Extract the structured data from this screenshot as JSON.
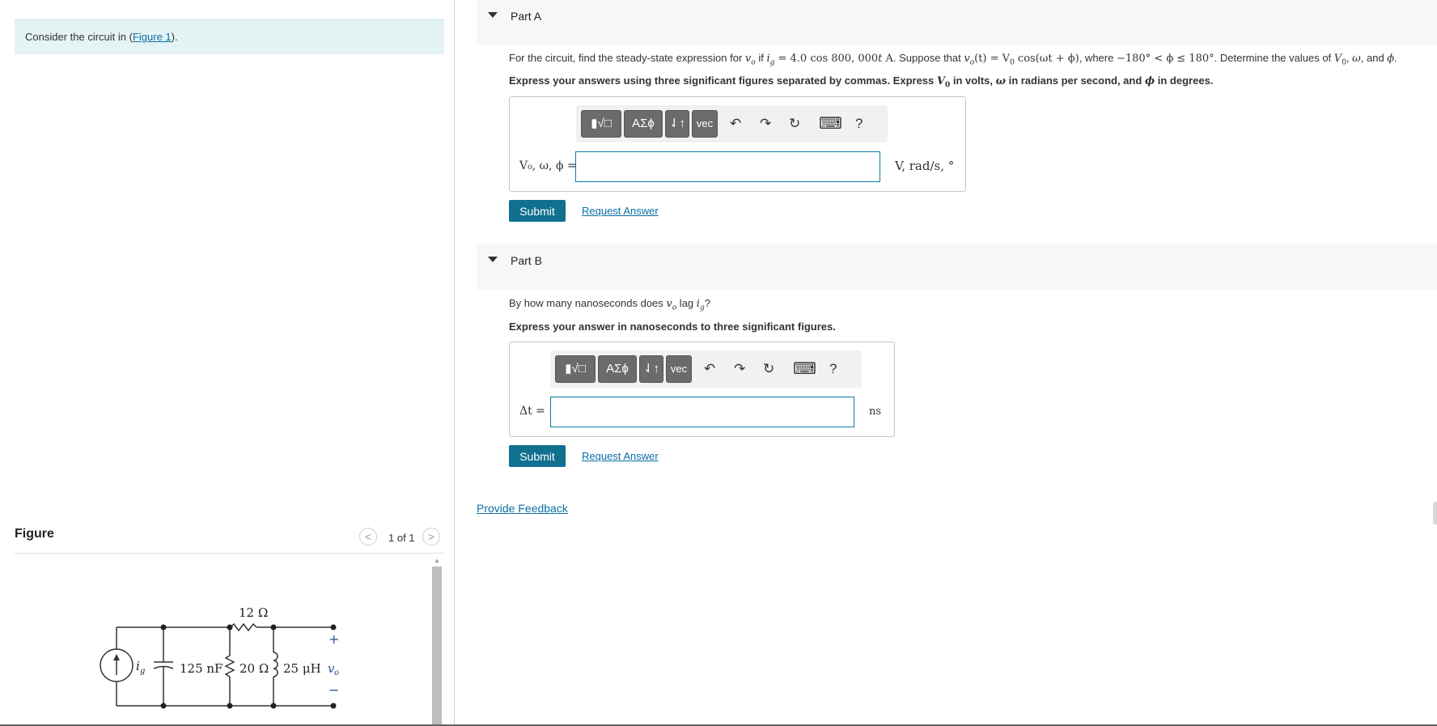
{
  "intro": {
    "prefix": "Consider the circuit in (",
    "link": "Figure 1",
    "suffix": ")."
  },
  "figure": {
    "title": "Figure",
    "counter": "1 of 1",
    "prev_icon": "<",
    "next_icon": ">",
    "labels": {
      "r_series": "12 Ω",
      "source": "i",
      "source_sub": "g",
      "capacitor": "125 nF",
      "r_shunt": "20 Ω",
      "inductor": "25 μH",
      "output": "v",
      "output_sub": "o",
      "plus": "+",
      "minus": "−"
    }
  },
  "partA": {
    "title": "Part A",
    "question": {
      "t1": "For the circuit, find the steady-state expression for ",
      "v": "v",
      "vsub": "o",
      "t2": " if ",
      "i": "i",
      "isub": "g",
      "t3": " = 4.0 cos 800, 000",
      "t4": "t",
      "t5": " A",
      "t6": ". Suppose that ",
      "expr": "v",
      "exprsub": "o",
      "expr2": "(t) = V",
      "expr2sub": "0",
      "expr3": " cos(ωt + ϕ)",
      "t7": ", where ",
      "range": "−180° < ϕ ≤ 180°",
      "t8": ". Determine the values of ",
      "vals": "V",
      "valssub": "0",
      "t9": ", ",
      "w": "ω",
      "t10": ", and ",
      "phi": "ϕ",
      "t11": "."
    },
    "instruction": {
      "t1": "Express your answers using three significant figures separated by commas. Express ",
      "v": "V",
      "vsub": "0",
      "t2": " in volts, ",
      "w": "ω",
      "t3": " in radians per second, and ",
      "phi": "ϕ",
      "t4": " in degrees."
    },
    "input_label": "V₀, ω, ϕ =",
    "input_value": "",
    "unit": "V, rad/s, °",
    "submit": "Submit",
    "request": "Request Answer"
  },
  "partB": {
    "title": "Part B",
    "question": {
      "t1": "By how many nanoseconds does ",
      "v": "v",
      "vsub": "o",
      "t2": " lag ",
      "i": "i",
      "isub": "g",
      "t3": "?"
    },
    "instruction": "Express your answer in nanoseconds to three significant figures.",
    "input_label": "Δt =",
    "input_value": "",
    "unit": "ns",
    "submit": "Submit",
    "request": "Request Answer"
  },
  "toolbar": {
    "templates": "▮√□",
    "greek": "ΑΣϕ",
    "arrows": "⇃↑",
    "vec": "vec",
    "undo": "↶",
    "redo": "↷",
    "reset": "↻",
    "keyboard": "⌨",
    "help": "?"
  },
  "feedback": "Provide Feedback"
}
